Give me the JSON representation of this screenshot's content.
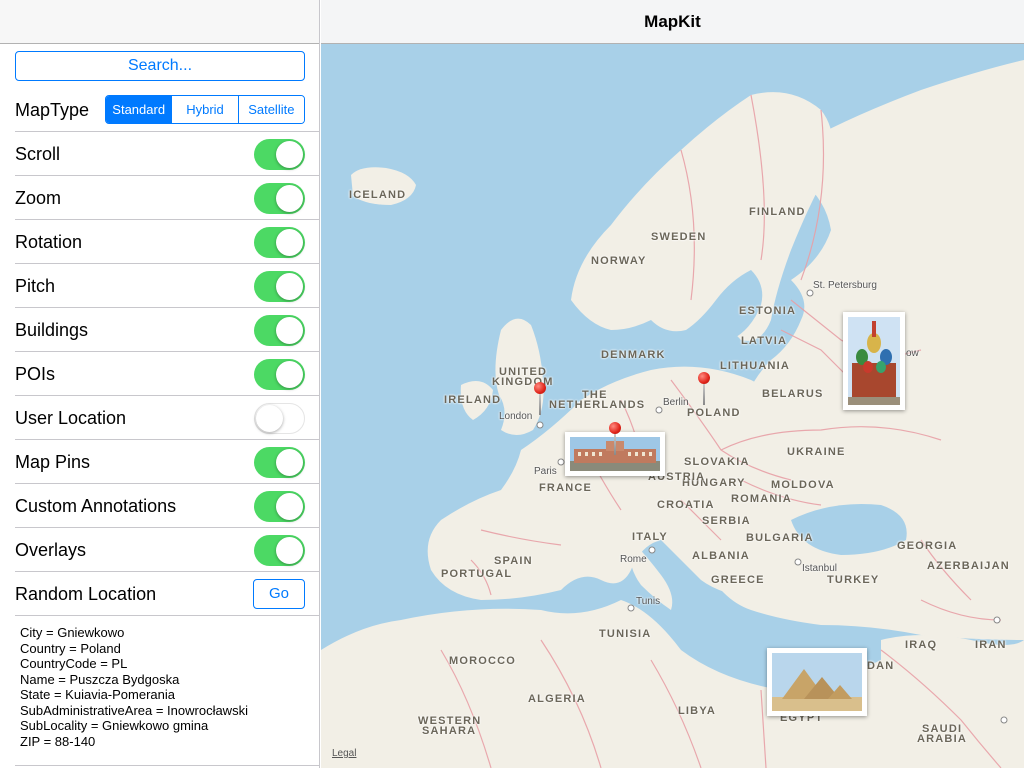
{
  "sidebar": {
    "search_label": "Search...",
    "maptype": {
      "label": "MapType",
      "options": [
        "Standard",
        "Hybrid",
        "Satellite"
      ],
      "selected": "Standard"
    },
    "toggles": [
      {
        "label": "Scroll",
        "on": true
      },
      {
        "label": "Zoom",
        "on": true
      },
      {
        "label": "Rotation",
        "on": true
      },
      {
        "label": "Pitch",
        "on": true
      },
      {
        "label": "Buildings",
        "on": true
      },
      {
        "label": "POIs",
        "on": true
      },
      {
        "label": "User Location",
        "on": false
      },
      {
        "label": "Map Pins",
        "on": true
      },
      {
        "label": "Custom Annotations",
        "on": true
      },
      {
        "label": "Overlays",
        "on": true
      }
    ],
    "random_location": {
      "label": "Random Location",
      "button": "Go"
    },
    "info_lines": [
      "City = Gniewkowo",
      "Country = Poland",
      "CountryCode = PL",
      "Name = Puszcza Bydgoska",
      "State = Kuiavia-Pomerania",
      "SubAdministrativeArea = Inowrocławski",
      "SubLocality = Gniewkowo gmina",
      "ZIP = 88-140"
    ]
  },
  "navbar": {
    "title": "MapKit"
  },
  "map": {
    "legal": "Legal",
    "countries": [
      "ICELAND",
      "FINLAND",
      "SWEDEN",
      "NORWAY",
      "ESTONIA",
      "LATVIA",
      "DENMARK",
      "LITHUANIA",
      "UNITED",
      "KINGDOM",
      "IRELAND",
      "THE",
      "NETHERLANDS",
      "POLAND",
      "BELARUS",
      "UKRAINE",
      "SLOVAKIA",
      "HUNGARY",
      "MOLDOVA",
      "AUSTRIA",
      "FRANCE",
      "CROATIA",
      "ROMANIA",
      "SERBIA",
      "BULGARIA",
      "ITALY",
      "SPAIN",
      "PORTUGAL",
      "ALBANIA",
      "GREECE",
      "TURKEY",
      "GEORGIA",
      "AZERBAIJAN",
      "TUNISIA",
      "MOROCCO",
      "ALGERIA",
      "LIBYA",
      "EGYPT",
      "IRAQ",
      "IRAN",
      "WESTERN",
      "SAHARA",
      "SAUDI",
      "ARABIA",
      "DAN"
    ],
    "cities": [
      "St. Petersburg",
      "London",
      "Berlin",
      "Paris",
      "Rome",
      "Istanbul",
      "Tunis",
      "ow"
    ],
    "water_color": "#a8d0e8",
    "land_color": "#f2efe6",
    "border_color": "#e8a0a6",
    "pin_color": "#e0241a",
    "photo_annotations": [
      "st-basils-cathedral-photo",
      "palace-photo",
      "pyramids-photo"
    ]
  }
}
